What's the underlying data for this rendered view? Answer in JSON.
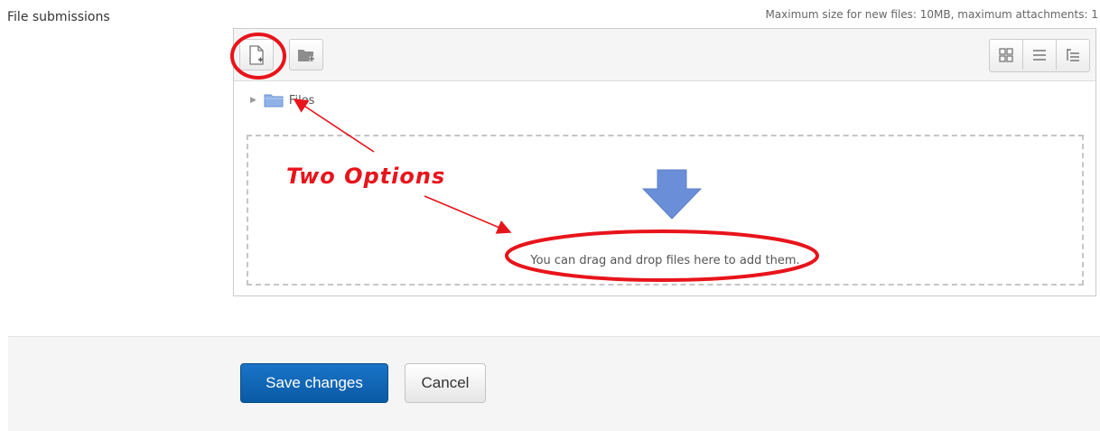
{
  "form": {
    "field_label": "File submissions",
    "limits_text": "Maximum size for new files: 10MB, maximum attachments: 1"
  },
  "filepicker": {
    "toolbar": {
      "add_file_icon": "add-file-icon",
      "create_folder_icon": "create-folder-icon",
      "view_icons_icon": "grid-view-icon",
      "view_list_icon": "list-view-icon",
      "view_tree_icon": "tree-view-icon"
    },
    "path": {
      "label": "Files"
    },
    "dropzone": {
      "message": "You can drag and drop files here to add them."
    }
  },
  "buttons": {
    "save_label": "Save changes",
    "cancel_label": "Cancel"
  },
  "annotation": {
    "text": "Two Options",
    "color": "#e8141b"
  },
  "colors": {
    "primary": "#0a5aa5",
    "arrow": "#6a8fd8",
    "folder": "#8fb2e8"
  }
}
